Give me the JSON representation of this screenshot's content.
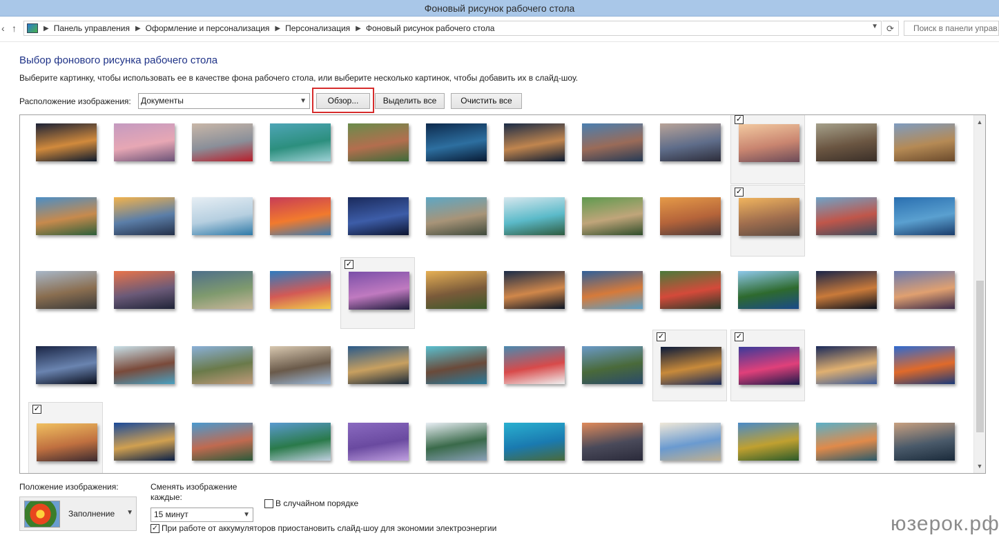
{
  "window": {
    "title": "Фоновый рисунок рабочего стола"
  },
  "address": {
    "breadcrumbs": [
      "Панель управления",
      "Оформление и персонализация",
      "Персонализация",
      "Фоновый рисунок рабочего стола"
    ],
    "search_placeholder": "Поиск в панели управ..."
  },
  "main": {
    "heading": "Выбор фонового рисунка рабочего стола",
    "subtitle": "Выберите картинку, чтобы использовать ее в качестве фона рабочего стола, или выберите несколько картинок, чтобы добавить их в слайд-шоу.",
    "location_label": "Расположение изображения:",
    "location_value": "Документы",
    "browse_label": "Обзор...",
    "select_all_label": "Выделить все",
    "clear_all_label": "Очистить все"
  },
  "gallery": {
    "rows": [
      [
        {
          "c": [
            "#1b2236",
            "#d18a3c",
            "#0d1a2e"
          ],
          "sel": false
        },
        {
          "c": [
            "#c49ac0",
            "#e7a7b4",
            "#6b5378"
          ],
          "sel": false
        },
        {
          "c": [
            "#c9b7a8",
            "#8a8f99",
            "#b81e2a"
          ],
          "sel": false
        },
        {
          "c": [
            "#4ea5b6",
            "#2c8f7e",
            "#9ed1d6"
          ],
          "sel": false
        },
        {
          "c": [
            "#6a8c4c",
            "#b36e4e",
            "#3d6b3a"
          ],
          "sel": false
        },
        {
          "c": [
            "#0d2a4d",
            "#2d6fa0",
            "#081a33"
          ],
          "sel": false
        },
        {
          "c": [
            "#1a2c47",
            "#c0854e",
            "#0d1c33"
          ],
          "sel": false
        },
        {
          "c": [
            "#4a7fb0",
            "#9a6b58",
            "#253a55"
          ],
          "sel": false
        },
        {
          "c": [
            "#b8a398",
            "#5f6d8a",
            "#2d2d3a"
          ],
          "sel": false
        },
        {
          "c": [
            "#f2c9a0",
            "#c98570",
            "#6b4b58"
          ],
          "sel": true
        },
        {
          "c": [
            "#a5a08a",
            "#6b5642",
            "#3a2f28"
          ],
          "sel": false
        },
        {
          "c": [
            "#7e9cc0",
            "#b58a55",
            "#6a4a2c"
          ],
          "sel": false
        }
      ],
      [
        {
          "c": [
            "#4b8ec6",
            "#c78a4d",
            "#2c5f3a"
          ],
          "sel": false
        },
        {
          "c": [
            "#f3b34c",
            "#5b7ea8",
            "#243049"
          ],
          "sel": false
        },
        {
          "c": [
            "#e6eef4",
            "#b6cfe0",
            "#2f7aa8"
          ],
          "sel": false
        },
        {
          "c": [
            "#c73c57",
            "#f27a2d",
            "#3a7ab0"
          ],
          "sel": false
        },
        {
          "c": [
            "#1a2a5c",
            "#3d5da8",
            "#0c1430"
          ],
          "sel": false
        },
        {
          "c": [
            "#5ea7c4",
            "#a89478",
            "#3f4a3c"
          ],
          "sel": false
        },
        {
          "c": [
            "#d6e7ee",
            "#5bbac9",
            "#2e5b3f"
          ],
          "sel": false
        },
        {
          "c": [
            "#5f9a4f",
            "#c0a57a",
            "#2f4d2a"
          ],
          "sel": false
        },
        {
          "c": [
            "#e59a48",
            "#b5643a",
            "#4a3a3a"
          ],
          "sel": false
        },
        {
          "c": [
            "#f0b45e",
            "#a06e4e",
            "#5a4a42"
          ],
          "sel": true
        },
        {
          "c": [
            "#6fa3c8",
            "#c0564a",
            "#3b4c5e"
          ],
          "sel": false
        },
        {
          "c": [
            "#2a6fb0",
            "#5aa0d0",
            "#1a3c6b"
          ],
          "sel": false
        }
      ],
      [
        {
          "c": [
            "#a8b7c8",
            "#8a6e50",
            "#3a3a3a"
          ],
          "sel": false
        },
        {
          "c": [
            "#e8744a",
            "#6b5a78",
            "#1f2438"
          ],
          "sel": false
        },
        {
          "c": [
            "#4e6f8a",
            "#7f9a6e",
            "#c9b69a"
          ],
          "sel": false
        },
        {
          "c": [
            "#2e7bbf",
            "#d35a55",
            "#f2d04a"
          ],
          "sel": false
        },
        {
          "c": [
            "#7a4fa8",
            "#c07ac0",
            "#1c1a3a"
          ],
          "sel": true
        },
        {
          "c": [
            "#e6b055",
            "#7a5a3a",
            "#3a5a2a"
          ],
          "sel": false
        },
        {
          "c": [
            "#1a2c48",
            "#d0874a",
            "#0c1626"
          ],
          "sel": false
        },
        {
          "c": [
            "#2f5f9a",
            "#d67a3a",
            "#5aa0c8"
          ],
          "sel": false
        },
        {
          "c": [
            "#4a7a3a",
            "#d44a3a",
            "#2a3a2a"
          ],
          "sel": false
        },
        {
          "c": [
            "#8ec8ea",
            "#2e6a2e",
            "#1a4a8a"
          ],
          "sel": false
        },
        {
          "c": [
            "#1a2548",
            "#c97a3a",
            "#08101e"
          ],
          "sel": false
        },
        {
          "c": [
            "#6a7ab0",
            "#e0a070",
            "#3a2a4a"
          ],
          "sel": false
        }
      ],
      [
        {
          "c": [
            "#1a2545",
            "#6a84b0",
            "#0a0f1e"
          ],
          "sel": false
        },
        {
          "c": [
            "#c8e0e8",
            "#7a4a3a",
            "#4aa0c0"
          ],
          "sel": false
        },
        {
          "c": [
            "#8ab0d8",
            "#6a7a4a",
            "#c09a7a"
          ],
          "sel": false
        },
        {
          "c": [
            "#d8c8b0",
            "#6a5a4a",
            "#9ab8d8"
          ],
          "sel": false
        },
        {
          "c": [
            "#2a5a8a",
            "#c8a060",
            "#1a2a3a"
          ],
          "sel": false
        },
        {
          "c": [
            "#5ac0d0",
            "#6a4a3a",
            "#2a7a9a"
          ],
          "sel": false
        },
        {
          "c": [
            "#4a8ab0",
            "#d84a4a",
            "#f0f0f0"
          ],
          "sel": false
        },
        {
          "c": [
            "#6a9ac8",
            "#4a6a3a",
            "#2a4a6a"
          ],
          "sel": false
        },
        {
          "c": [
            "#0a1a3a",
            "#c88a3a",
            "#1a2a5a"
          ],
          "sel": true
        },
        {
          "c": [
            "#3a3a9a",
            "#e0407a",
            "#1a1a4a"
          ],
          "sel": true
        },
        {
          "c": [
            "#1a2a5a",
            "#e0b070",
            "#3a5a9a"
          ],
          "sel": false
        },
        {
          "c": [
            "#2e6ad0",
            "#e06a2a",
            "#1a3a7a"
          ],
          "sel": false
        }
      ],
      [
        {
          "c": [
            "#f0c060",
            "#c07040",
            "#3a2a30"
          ],
          "sel": true
        },
        {
          "c": [
            "#1a4a9a",
            "#d0a050",
            "#0a2048"
          ],
          "sel": false
        },
        {
          "c": [
            "#4a9ad0",
            "#c06a50",
            "#2a5a3a"
          ],
          "sel": false
        },
        {
          "c": [
            "#5a9ad0",
            "#2a7a4a",
            "#c0d0e0"
          ],
          "sel": false
        },
        {
          "c": [
            "#8a6ac0",
            "#6a4aa0",
            "#c0a0e0"
          ],
          "sel": false
        },
        {
          "c": [
            "#e8eef4",
            "#3a6a4a",
            "#8aa0b8"
          ],
          "sel": false
        },
        {
          "c": [
            "#2ab0d0",
            "#1a7ab0",
            "#4a6a3a"
          ],
          "sel": false
        },
        {
          "c": [
            "#e08a5a",
            "#4a4a5a",
            "#2a2a3a"
          ],
          "sel": false
        },
        {
          "c": [
            "#f0e8d8",
            "#6a9ad0",
            "#c0b090"
          ],
          "sel": false
        },
        {
          "c": [
            "#4a8ac8",
            "#c0a030",
            "#2a5a2a"
          ],
          "sel": false
        },
        {
          "c": [
            "#5ab0c8",
            "#e08a4a",
            "#2a5a6a"
          ],
          "sel": false
        },
        {
          "c": [
            "#c8a080",
            "#4a5a6a",
            "#1a2a3a"
          ],
          "sel": false
        }
      ]
    ]
  },
  "bottom": {
    "position_label": "Положение изображения:",
    "position_value": "Заполнение",
    "change_label": "Сменять изображение каждые:",
    "change_value": "15 минут",
    "shuffle_label": "В случайном порядке",
    "shuffle_checked": false,
    "battery_label": "При работе от аккумуляторов приостановить слайд-шоу для экономии электроэнергии",
    "battery_checked": true
  },
  "watermark": "юзерок.рф"
}
